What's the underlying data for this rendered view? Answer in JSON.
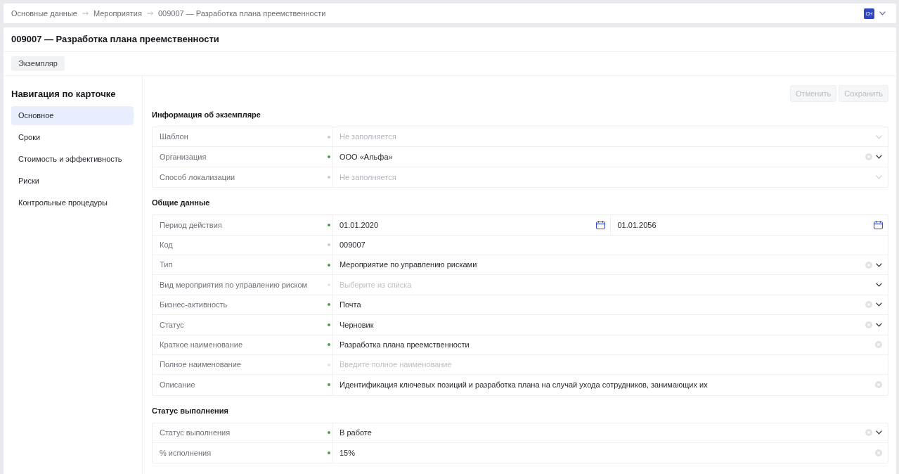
{
  "breadcrumbs": [
    {
      "label": "Основные данные"
    },
    {
      "label": "Мероприятия"
    },
    {
      "label": "009007 — Разработка плана преемственности"
    }
  ],
  "user": {
    "initials": "СН"
  },
  "title": "009007 — Разработка плана преемственности",
  "tabs": [
    {
      "label": "Экземпляр",
      "selected": true
    }
  ],
  "card_navigation": {
    "title": "Навигация по карточке",
    "items": [
      {
        "label": "Основное",
        "selected": true
      },
      {
        "label": "Сроки",
        "selected": false
      },
      {
        "label": "Стоимость и эффективность",
        "selected": false
      },
      {
        "label": "Риски",
        "selected": false
      },
      {
        "label": "Контрольные процедуры",
        "selected": false
      }
    ]
  },
  "actions": [
    {
      "label": "Отменить",
      "disabled": true
    },
    {
      "label": "Сохранить",
      "disabled": true
    }
  ],
  "sections": [
    {
      "title": "Информация об экземпляре",
      "fields": [
        {
          "kind": "select",
          "label": "Шаблон",
          "color": "#c9ccd1",
          "placeholder": "Не заполняется",
          "disabled": true
        },
        {
          "kind": "select",
          "label": "Организация",
          "color": "#4b9e48",
          "value": "ООО «Альфа»",
          "disabled": false
        },
        {
          "kind": "select",
          "label": "Способ локализации",
          "color": "#c9ccd1",
          "placeholder": "Не заполняется",
          "disabled": true
        }
      ]
    },
    {
      "title": "Общие данные",
      "fields": [
        {
          "kind": "date_range",
          "label": "Период действия",
          "color": "#4b9e48",
          "start": "01.01.2020",
          "end": "01.01.2056",
          "disabled": false
        },
        {
          "kind": "static",
          "label": "Код",
          "color": "#c9ccd1",
          "value": "009007",
          "disabled": false
        },
        {
          "kind": "select",
          "label": "Тип",
          "color": "#4b9e48",
          "value": "Мероприятие по управлению рисками",
          "disabled": false
        },
        {
          "kind": "select",
          "label": "Вид мероприятия по управлению риском",
          "color": "#e2e4e7",
          "placeholder": "Выберите из списка",
          "disabled": false
        },
        {
          "kind": "select",
          "label": "Бизнес-активность",
          "color": "#4b9e48",
          "value": "Почта",
          "disabled": false
        },
        {
          "kind": "select",
          "label": "Статус",
          "color": "#4b9e48",
          "value": "Черновик",
          "disabled": false
        },
        {
          "kind": "text",
          "label": "Краткое наименование",
          "color": "#4b9e48",
          "value": "Разработка плана преемственности",
          "disabled": false
        },
        {
          "kind": "text",
          "label": "Полное наименование",
          "color": "#e2e4e7",
          "placeholder": "Введите полное наименование",
          "disabled": false
        },
        {
          "kind": "text",
          "label": "Описание",
          "color": "#4b9e48",
          "value": "Идентификация ключевых позиций и разработка плана на случай ухода сотрудников, занимающих их",
          "disabled": false
        }
      ]
    },
    {
      "title": "Статус выполнения",
      "fields": [
        {
          "kind": "select",
          "label": "Статус выполнения",
          "color": "#4b9e48",
          "value": "В работе",
          "disabled": false
        },
        {
          "kind": "text",
          "label": "% исполнения",
          "color": "#4b9e48",
          "value": "15%",
          "disabled": false
        }
      ]
    }
  ]
}
